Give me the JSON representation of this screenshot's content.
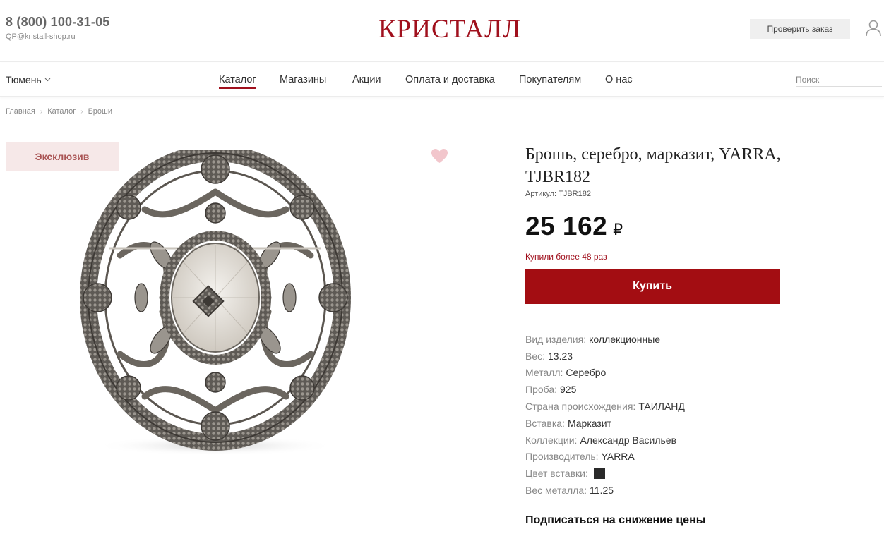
{
  "header": {
    "phone": "8 (800) 100-31-05",
    "email": "QP@kristall-shop.ru",
    "logo": "КРИСТАЛЛ",
    "check_order_label": "Проверить заказ",
    "user_icon": "user-icon"
  },
  "nav": {
    "city": "Тюмень",
    "items": [
      {
        "label": "Каталог",
        "active": true
      },
      {
        "label": "Магазины",
        "active": false
      },
      {
        "label": "Акции",
        "active": false
      },
      {
        "label": "Оплата и доставка",
        "active": false
      },
      {
        "label": "Покупателям",
        "active": false
      },
      {
        "label": "О нас",
        "active": false
      }
    ],
    "search_placeholder": "Поиск"
  },
  "breadcrumb": [
    "Главная",
    "Каталог",
    "Броши"
  ],
  "product": {
    "badge": "Эксклюзив",
    "favorite_icon": "heart-icon",
    "title": "Брошь, серебро, марказит, YARRA, TJBR182",
    "sku_label": "Артикул:",
    "sku_value": "TJBR182",
    "price": "25 162",
    "currency": "₽",
    "bought_text": "Купили более 48 раз",
    "buy_label": "Купить",
    "specs": [
      {
        "label": "Вид изделия:",
        "value": "коллекционные"
      },
      {
        "label": "Вес:",
        "value": "13.23"
      },
      {
        "label": "Металл:",
        "value": "Серебро"
      },
      {
        "label": "Проба:",
        "value": "925"
      },
      {
        "label": "Страна происхождения:",
        "value": "ТАИЛАНД"
      },
      {
        "label": "Вставка:",
        "value": "Марказит"
      },
      {
        "label": "Коллекции:",
        "value": "Александр Васильев"
      },
      {
        "label": "Производитель:",
        "value": "YARRA"
      },
      {
        "label": "Цвет вставки:",
        "value": "",
        "swatch": "#2a2a2a"
      },
      {
        "label": "Вес металла:",
        "value": "11.25"
      }
    ],
    "subscribe_label": "Подписаться на снижение цены"
  },
  "colors": {
    "accent": "#a0101d",
    "buy_button": "#a30d12",
    "badge_bg": "#f6e8e8",
    "heart": "#f2c6cc"
  }
}
